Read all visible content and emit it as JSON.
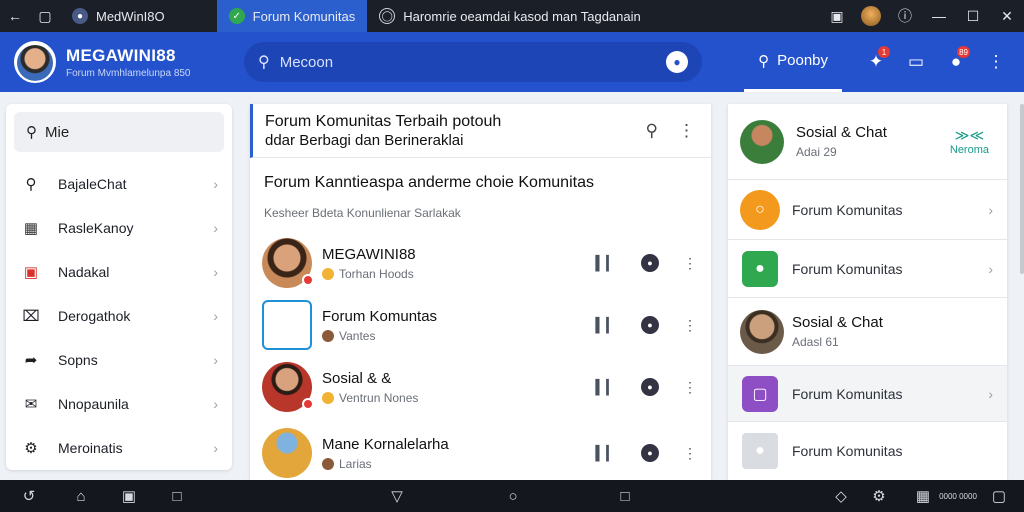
{
  "titlebar": {
    "window_title": "MedWinI8O",
    "tabs": [
      {
        "label": "Forum Komunitas",
        "active": true
      },
      {
        "label": "Haromrie oeamdai kasod man Tagdanain",
        "active": false
      }
    ]
  },
  "header": {
    "brand_name": "MEGAWINI88",
    "brand_sub": "Forum Mvmhlamelunpa 850",
    "search_placeholder": "Mecoon",
    "tab_label": "Poonby",
    "badges": {
      "apps": "1",
      "notifications": "89"
    }
  },
  "left_panel": {
    "search_value": "Mie",
    "items": [
      {
        "label": "BajaleChat",
        "icon": "search-icon"
      },
      {
        "label": "RasleKanoy",
        "icon": "chart-icon"
      },
      {
        "label": "Nadakal",
        "icon": "folder-icon"
      },
      {
        "label": "Derogathok",
        "icon": "close-box-icon"
      },
      {
        "label": "Sopns",
        "icon": "share-icon"
      },
      {
        "label": "Nnopaunila",
        "icon": "inbox-icon"
      },
      {
        "label": "Meroinatis",
        "icon": "gear-icon"
      }
    ]
  },
  "main": {
    "title_line1": "Forum Komunitas Terbaih potouh",
    "title_line2": "ddar Berbagi dan Berineraklai",
    "subtitle": "Forum Kanntieaspa anderme choie Komunitas",
    "meta": "Kesheer Bdeta Konunlienar Sarlakak",
    "posts": [
      {
        "title": "MEGAWINI88",
        "meta": "Torhan Hoods",
        "avatar_color": "#c98a5a"
      },
      {
        "title": "Forum Komuntas",
        "meta": "Vantes",
        "avatar_color": "#1f8fd6"
      },
      {
        "title": "Sosial & &",
        "meta": "Ventrun Nones",
        "avatar_color": "#b8362a"
      },
      {
        "title": "Mane Kornalelarha",
        "meta": "Larias",
        "avatar_color": "#e2a63b"
      }
    ]
  },
  "right_panel": {
    "items": [
      {
        "label": "Sosial & Chat",
        "sub": "Adai 29",
        "action": "Neroma",
        "color": "#3b7d3b"
      },
      {
        "label": "Forum Komunitas",
        "sub": "",
        "color": "#f39a1e"
      },
      {
        "label": "Forum Komunitas",
        "sub": "",
        "color": "#2fa84f"
      },
      {
        "label": "Sosial & Chat",
        "sub": "Adasl 61",
        "color": "#6b5a48"
      },
      {
        "label": "Forum Komunitas",
        "sub": "",
        "color": "#8e4fc4"
      },
      {
        "label": "Forum Komunitas",
        "sub": "",
        "color": "#cfd3d9"
      }
    ]
  },
  "bottom_bar": {
    "clock": "0000 0000"
  },
  "colors": {
    "header_bg": "#2452cc",
    "accent": "#2b5fce",
    "badge": "#e53935"
  }
}
